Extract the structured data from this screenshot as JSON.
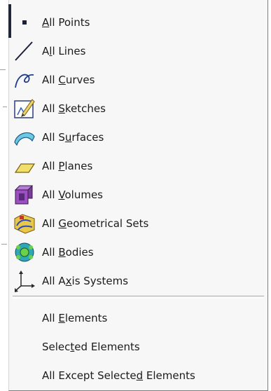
{
  "menu": {
    "items": [
      {
        "icon": "point-icon",
        "pre": "",
        "ul": "A",
        "post": "ll Points"
      },
      {
        "icon": "line-icon",
        "pre": "A",
        "ul": "l",
        "post": "l Lines"
      },
      {
        "icon": "curve-icon",
        "pre": "All ",
        "ul": "C",
        "post": "urves"
      },
      {
        "icon": "sketch-icon",
        "pre": "All ",
        "ul": "S",
        "post": "ketches"
      },
      {
        "icon": "surface-icon",
        "pre": "All S",
        "ul": "u",
        "post": "rfaces"
      },
      {
        "icon": "plane-icon",
        "pre": "All ",
        "ul": "P",
        "post": "lanes"
      },
      {
        "icon": "volume-icon",
        "pre": "All ",
        "ul": "V",
        "post": "olumes"
      },
      {
        "icon": "geometrical-set-icon",
        "pre": "All ",
        "ul": "G",
        "post": "eometrical Sets"
      },
      {
        "icon": "body-icon",
        "pre": "All ",
        "ul": "B",
        "post": "odies"
      },
      {
        "icon": "axis-system-icon",
        "pre": "All A",
        "ul": "x",
        "post": "is Systems"
      }
    ],
    "elements": [
      {
        "pre": "All ",
        "ul": "E",
        "post": "lements"
      },
      {
        "pre": "Selec",
        "ul": "t",
        "post": "ed Elements"
      },
      {
        "pre": "All Except Selecte",
        "ul": "d",
        "post": " Elements"
      }
    ]
  },
  "colors": {
    "menu_bg": "#f7f7f7",
    "text": "#1b1b1b",
    "accent_dark": "#22283a"
  }
}
